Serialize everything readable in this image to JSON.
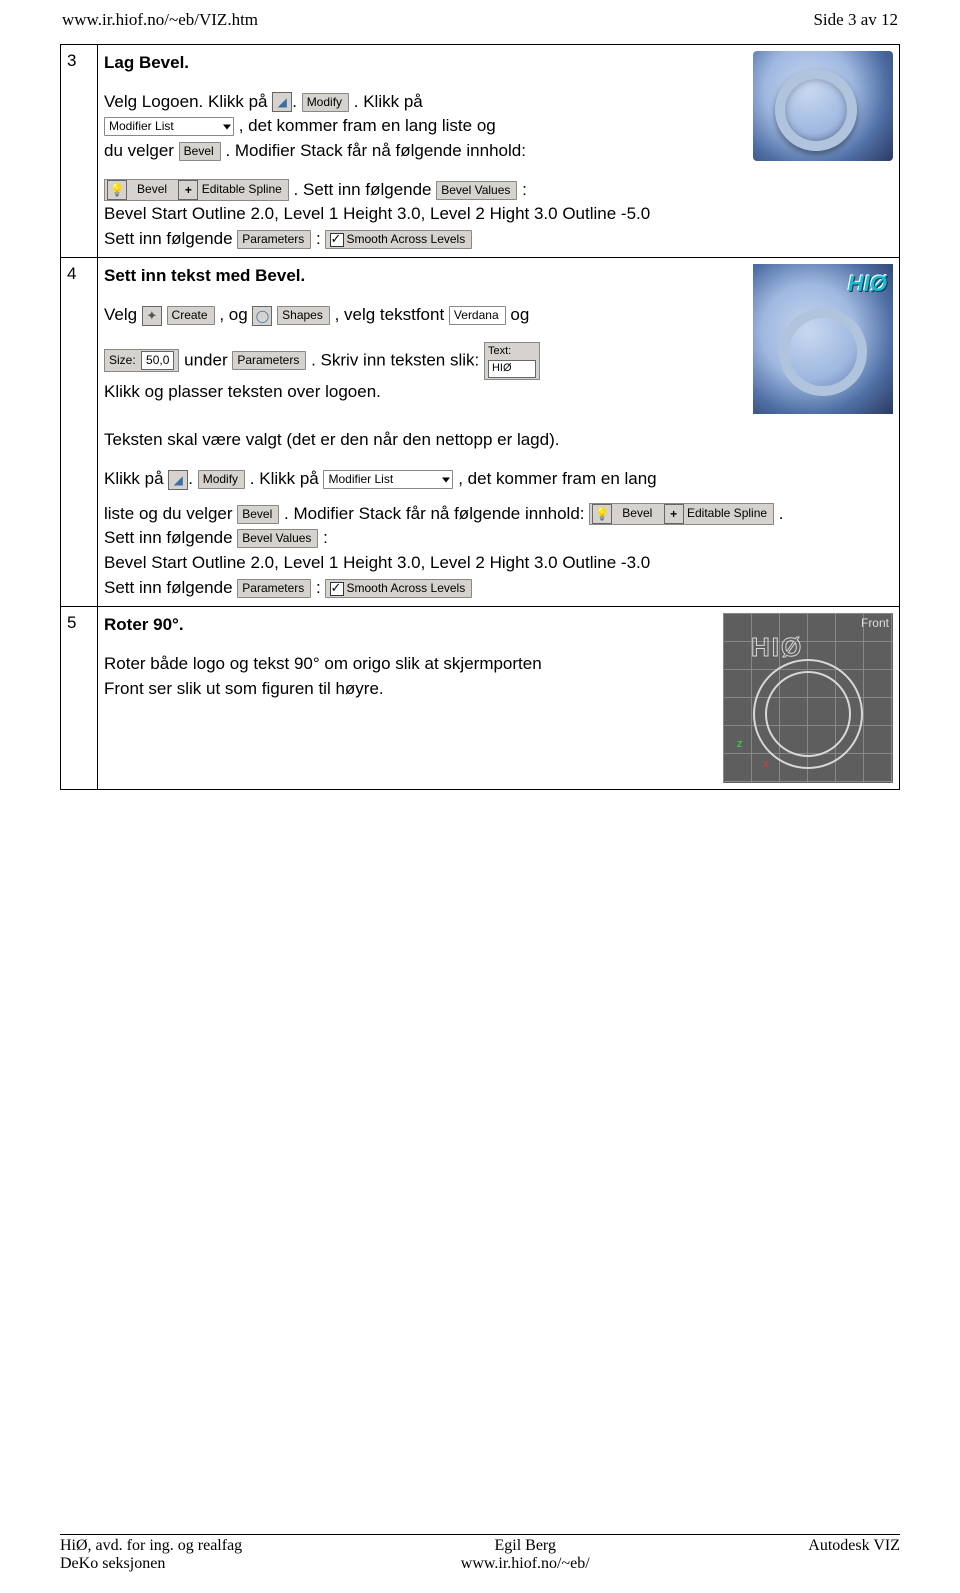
{
  "header": {
    "url": "www.ir.hiof.no/~eb/VIZ.htm",
    "page": "Side 3 av 12"
  },
  "ui_labels": {
    "modify": "Modify",
    "modifier_list": "Modifier List",
    "bevel": "Bevel",
    "editable_spline": "Editable Spline",
    "bevel_values": "Bevel Values",
    "parameters": "Parameters",
    "smooth": "Smooth Across Levels",
    "create": "Create",
    "shapes": "Shapes",
    "verdana": "Verdana",
    "size_label": "Size:",
    "size_value": "50,0",
    "text_label": "Text:",
    "text_value": "HIØ",
    "front": "Front",
    "hio_title": "HIØ"
  },
  "rows": [
    {
      "num": "3",
      "title": "Lag Bevel.",
      "p1a": "Velg Logoen. Klikk på ",
      "p1b": ". Klikk på",
      "p2a": ", det kommer fram en lang liste og",
      "p2b": "du velger ",
      "p2c": ". Modifier Stack får nå følgende innhold:",
      "p3a": ". Sett inn følgende ",
      "p3b": ":",
      "p4": "Bevel Start Outline 2.0, Level 1 Height 3.0, Level 2 Hight 3.0 Outline -5.0",
      "p5a": "Sett inn følgende ",
      "p5b": ": "
    },
    {
      "num": "4",
      "title": "Sett inn tekst med Bevel.",
      "p1a": "Velg ",
      "p1b": ", og ",
      "p1c": ", velg tekstfont ",
      "p1d": "og",
      "p2a": "under ",
      "p2b": ". Skriv inn teksten slik: ",
      "p3": "Klikk og plasser teksten over logoen.",
      "p4": "Teksten skal være valgt (det er den når den nettopp er lagd).",
      "p5a": "Klikk på ",
      "p5b": ". Klikk på ",
      "p5c": ", det kommer fram en lang",
      "p6a": "liste og du velger ",
      "p6b": ". Modifier Stack får nå følgende innhold: ",
      "p6c": ".",
      "p7a": "Sett inn følgende ",
      "p7b": ":",
      "p8": "Bevel Start Outline 2.0, Level 1 Height 3.0, Level 2 Hight 3.0 Outline -3.0",
      "p9a": "Sett inn følgende ",
      "p9b": ": "
    },
    {
      "num": "5",
      "title": "Roter  90°.",
      "p1": "Roter både logo og tekst 90° om origo slik at skjermporten Front ser slik ut som figuren til høyre."
    }
  ],
  "footer": {
    "left": "HiØ, avd. for ing. og realfag\nDeKo seksjonen",
    "center": "Egil Berg\nwww.ir.hiof.no/~eb/",
    "right": "Autodesk VIZ"
  }
}
